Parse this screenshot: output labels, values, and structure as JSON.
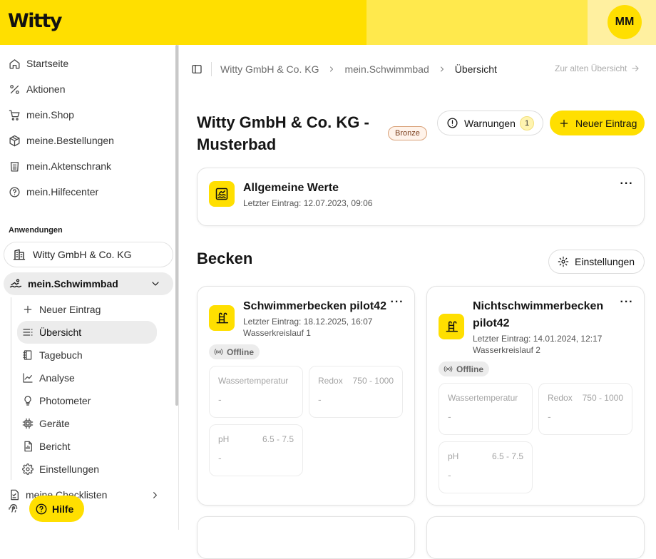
{
  "app": {
    "logo": "Witty",
    "user_initials": "MM"
  },
  "sidebar": {
    "nav": [
      {
        "label": "Startseite",
        "icon": "home-icon"
      },
      {
        "label": "Aktionen",
        "icon": "percent-icon"
      },
      {
        "label": "mein.Shop",
        "icon": "cart-icon"
      },
      {
        "label": "meine.Bestellungen",
        "icon": "package-icon"
      },
      {
        "label": "mein.Aktenschrank",
        "icon": "archive-icon"
      },
      {
        "label": "mein.Hilfecenter",
        "icon": "help-circle-icon"
      }
    ],
    "section_title": "Anwendungen",
    "company": "Witty GmbH & Co. KG",
    "pool_app": "mein.Schwimmbad",
    "pool_items": [
      {
        "label": "Neuer Eintrag",
        "icon": "plus-icon"
      },
      {
        "label": "Übersicht",
        "icon": "list-icon",
        "active": true
      },
      {
        "label": "Tagebuch",
        "icon": "notebook-icon"
      },
      {
        "label": "Analyse",
        "icon": "chart-line-icon"
      },
      {
        "label": "Photometer",
        "icon": "lightbulb-icon"
      },
      {
        "label": "Geräte",
        "icon": "chip-icon"
      },
      {
        "label": "Bericht",
        "icon": "report-icon"
      },
      {
        "label": "Einstellungen",
        "icon": "gear-icon"
      }
    ],
    "checklists": "meine.Checklisten",
    "help": "Hilfe"
  },
  "breadcrumb": {
    "items": [
      "Witty GmbH & Co. KG",
      "mein.Schwimmbad",
      "Übersicht"
    ],
    "old_view_link": "Zur alten Übersicht"
  },
  "header": {
    "title": "Witty GmbH & Co. KG - Musterbad",
    "badge": "Bronze",
    "warnings_label": "Warnungen",
    "warnings_count": "1",
    "new_entry_label": "Neuer Eintrag"
  },
  "general": {
    "title": "Allgemeine Werte",
    "last_entry": "Letzter Eintrag: 12.07.2023, 09:06"
  },
  "basins": {
    "heading": "Becken",
    "settings_label": "Einstellungen",
    "cards": [
      {
        "title": "Schwimmerbecken pilot42",
        "last_entry": "Letzter Eintrag: 18.12.2025, 16:07",
        "circuit": "Wasserkreislauf 1",
        "status": "Offline",
        "metrics": [
          {
            "label": "Wassertemperatur",
            "range": "",
            "value": "-"
          },
          {
            "label": "Redox",
            "range": "750 - 1000",
            "value": "-"
          },
          {
            "label": "pH",
            "range": "6.5 - 7.5",
            "value": "-"
          }
        ]
      },
      {
        "title": "Nichtschwimmerbecken pilot42",
        "last_entry": "Letzter Eintrag: 14.01.2024, 12:17",
        "circuit": "Wasserkreislauf 2",
        "status": "Offline",
        "metrics": [
          {
            "label": "Wassertemperatur",
            "range": "",
            "value": "-"
          },
          {
            "label": "Redox",
            "range": "750 - 1000",
            "value": "-"
          },
          {
            "label": "pH",
            "range": "6.5 - 7.5",
            "value": "-"
          }
        ]
      }
    ]
  },
  "colors": {
    "brand_yellow": "#ffdf00",
    "badge_bronze": "#d9a27a"
  }
}
